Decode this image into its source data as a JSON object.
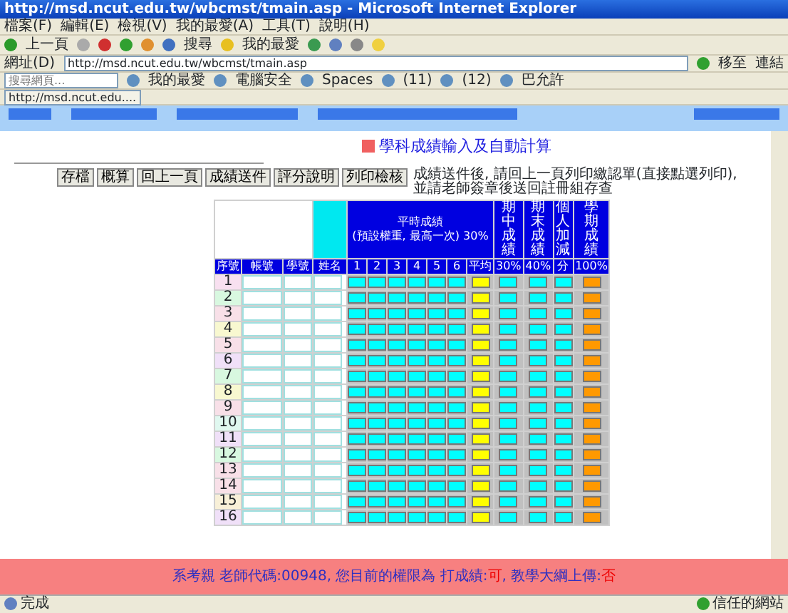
{
  "window": {
    "title": "http://msd.ncut.edu.tw/wbcmst/tmain.asp - Microsoft Internet Explorer"
  },
  "menu": [
    "檔案(F)",
    "編輯(E)",
    "檢視(V)",
    "我的最愛(A)",
    "工具(T)",
    "說明(H)"
  ],
  "toolbar": {
    "back": "上一頁",
    "search": "搜尋",
    "favorites": "我的最愛"
  },
  "address": {
    "label": "網址(D)",
    "url": "http://msd.ncut.edu.tw/wbcmst/tmain.asp",
    "go": "移至",
    "links": "連結"
  },
  "links_bar": {
    "placeholder": "搜尋網頁...",
    "items": [
      "我的最愛",
      "電腦安全",
      "Spaces",
      "(11)",
      "(12)",
      "巴允許"
    ]
  },
  "tab": {
    "label": "http://msd.ncut.edu...."
  },
  "page": {
    "heading": "學科成績輸入及自動計算",
    "buttons": [
      "存檔",
      "概算",
      "回上一頁",
      "成績送件",
      "評分說明",
      "列印檢核"
    ],
    "note": "成績送件後, 請回上一頁列印繳認單(直接點選列印),\n並請老師簽章後送回註冊組存查",
    "table": {
      "group_header": "平時成績\n(預設權重, 最高一次) 30%",
      "side_headers": [
        "期中成績",
        "期末成績",
        "個人加減",
        "學期成績"
      ],
      "columns": [
        "序號",
        "帳號",
        "學號",
        "姓名",
        "1",
        "2",
        "3",
        "4",
        "5",
        "6",
        "平均",
        "30%",
        "40%",
        "分",
        "100%"
      ],
      "rows": [
        {
          "no": "1",
          "color": "#f8e0f0"
        },
        {
          "no": "2",
          "color": "#d8f8e0"
        },
        {
          "no": "3",
          "color": "#f8e0e8"
        },
        {
          "no": "4",
          "color": "#f8f8d0"
        },
        {
          "no": "5",
          "color": "#f8e0e8"
        },
        {
          "no": "6",
          "color": "#f0e0f8"
        },
        {
          "no": "7",
          "color": "#d8f8e0"
        },
        {
          "no": "8",
          "color": "#f8f8d0"
        },
        {
          "no": "9",
          "color": "#f8e0e8"
        },
        {
          "no": "10",
          "color": "#e0f8f0"
        },
        {
          "no": "11",
          "color": "#f0e0f8"
        },
        {
          "no": "12",
          "color": "#d8f8e0"
        },
        {
          "no": "13",
          "color": "#f8e0e8"
        },
        {
          "no": "14",
          "color": "#f8e0e8"
        },
        {
          "no": "15",
          "color": "#f8f0d8"
        },
        {
          "no": "16",
          "color": "#f0e0f8"
        }
      ]
    },
    "footer": {
      "text": "系考親 老師代碼:00948, 您目前的權限為 打成績:",
      "grade": "可",
      "mid": ", 教學大綱上傳:",
      "syllabus": "否"
    }
  },
  "status_bar": {
    "text": "完成",
    "zone": "信任的網站"
  }
}
